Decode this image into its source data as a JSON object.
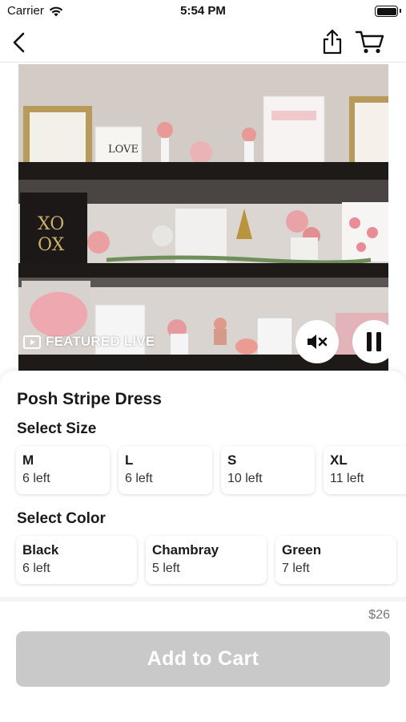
{
  "status_bar": {
    "carrier": "Carrier",
    "time": "5:54 PM"
  },
  "nav": {
    "back_icon": "chevron-left-icon",
    "share_icon": "share-icon",
    "cart_icon": "cart-icon"
  },
  "media": {
    "badge_text": "FEATURED LIVE",
    "badge_icon": "live-video-icon",
    "mute_icon": "speaker-muted-icon",
    "pause_icon": "pause-icon"
  },
  "product": {
    "title": "Posh Stripe Dress",
    "size_label": "Select Size",
    "sizes": [
      {
        "name": "M",
        "stock": "6 left"
      },
      {
        "name": "L",
        "stock": "6 left"
      },
      {
        "name": "S",
        "stock": "10 left"
      },
      {
        "name": "XL",
        "stock": "11 left"
      }
    ],
    "color_label": "Select Color",
    "colors": [
      {
        "name": "Black",
        "stock": "6 left"
      },
      {
        "name": "Chambray",
        "stock": "5 left"
      },
      {
        "name": "Green",
        "stock": "7 left"
      }
    ],
    "price": "$26",
    "add_to_cart": "Add to Cart"
  },
  "colors": {
    "button_disabled": "#c9c9c9",
    "shelf": "#1e1a18",
    "wall": "#d9d2cd"
  }
}
